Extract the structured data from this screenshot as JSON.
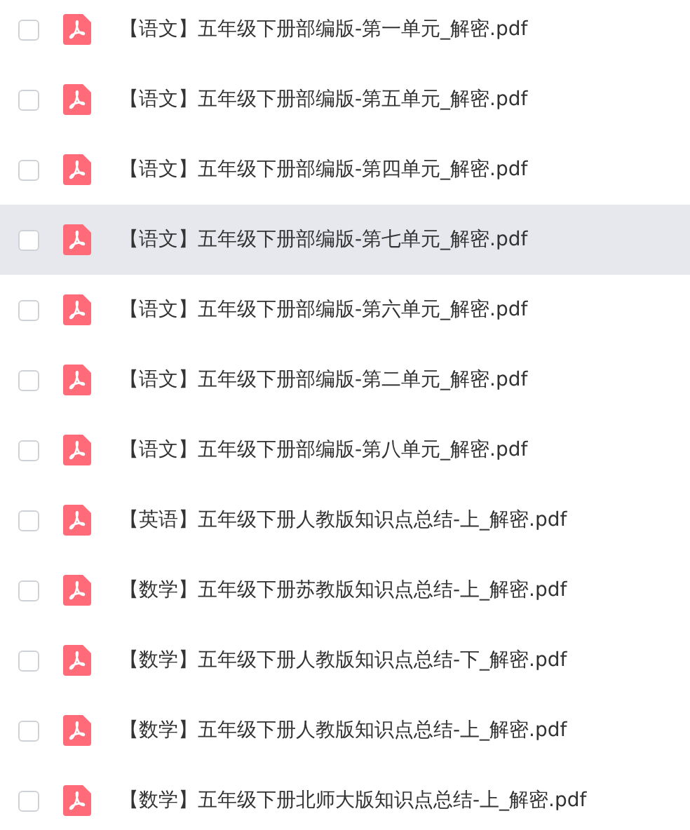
{
  "files": [
    {
      "name": "【语文】五年级下册部编版-第一单元_解密.pdf",
      "checked": false,
      "hovered": false
    },
    {
      "name": "【语文】五年级下册部编版-第五单元_解密.pdf",
      "checked": false,
      "hovered": false
    },
    {
      "name": "【语文】五年级下册部编版-第四单元_解密.pdf",
      "checked": false,
      "hovered": false
    },
    {
      "name": "【语文】五年级下册部编版-第七单元_解密.pdf",
      "checked": false,
      "hovered": true
    },
    {
      "name": "【语文】五年级下册部编版-第六单元_解密.pdf",
      "checked": false,
      "hovered": false
    },
    {
      "name": "【语文】五年级下册部编版-第二单元_解密.pdf",
      "checked": false,
      "hovered": false
    },
    {
      "name": "【语文】五年级下册部编版-第八单元_解密.pdf",
      "checked": false,
      "hovered": false
    },
    {
      "name": "【英语】五年级下册人教版知识点总结-上_解密.pdf",
      "checked": false,
      "hovered": false
    },
    {
      "name": "【数学】五年级下册苏教版知识点总结-上_解密.pdf",
      "checked": false,
      "hovered": false
    },
    {
      "name": "【数学】五年级下册人教版知识点总结-下_解密.pdf",
      "checked": false,
      "hovered": false
    },
    {
      "name": "【数学】五年级下册人教版知识点总结-上_解密.pdf",
      "checked": false,
      "hovered": false
    },
    {
      "name": "【数学】五年级下册北师大版知识点总结-上_解密.pdf",
      "checked": false,
      "hovered": false
    }
  ]
}
